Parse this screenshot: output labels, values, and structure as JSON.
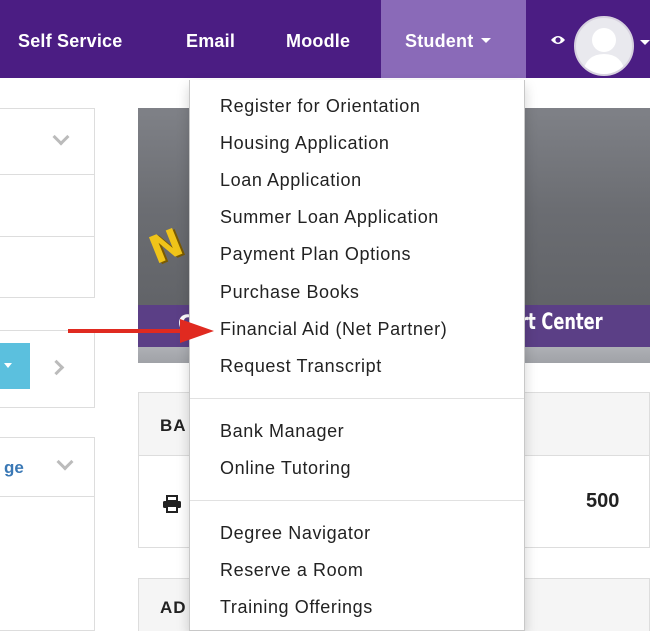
{
  "nav": {
    "self_service": "Self Service",
    "email": "Email",
    "moodle": "Moodle",
    "student": "Student"
  },
  "dropdown": {
    "group1": [
      "Register for Orientation",
      "Housing Application",
      "Loan Application",
      "Summer Loan Application",
      "Payment Plan Options",
      "Purchase Books",
      "Financial Aid (Net Partner)",
      "Request Transcript"
    ],
    "group2": [
      "Bank Manager",
      "Online Tutoring"
    ],
    "group3": [
      "Degree Navigator",
      "Reserve a Room",
      "Training Offerings"
    ]
  },
  "left_panel": {
    "partial_label": "ge"
  },
  "banner": {
    "partial_left": "C",
    "partial_right": "rt Center",
    "partial_gold": "N"
  },
  "panels": {
    "panel1_title": "BA",
    "panel1_value": "500",
    "panel2_title": "AD"
  },
  "colors": {
    "nav_bg": "#4b1d83",
    "nav_active_bg": "#8a6ab8",
    "arrow": "#e02a20",
    "link_blue": "#3a78b5",
    "tab_blue": "#5bc0de"
  },
  "icons": [
    "eye-icon",
    "avatar",
    "caret-down-icon",
    "chevron-down-icon",
    "chevron-right-icon",
    "print-icon",
    "red-arrow"
  ]
}
